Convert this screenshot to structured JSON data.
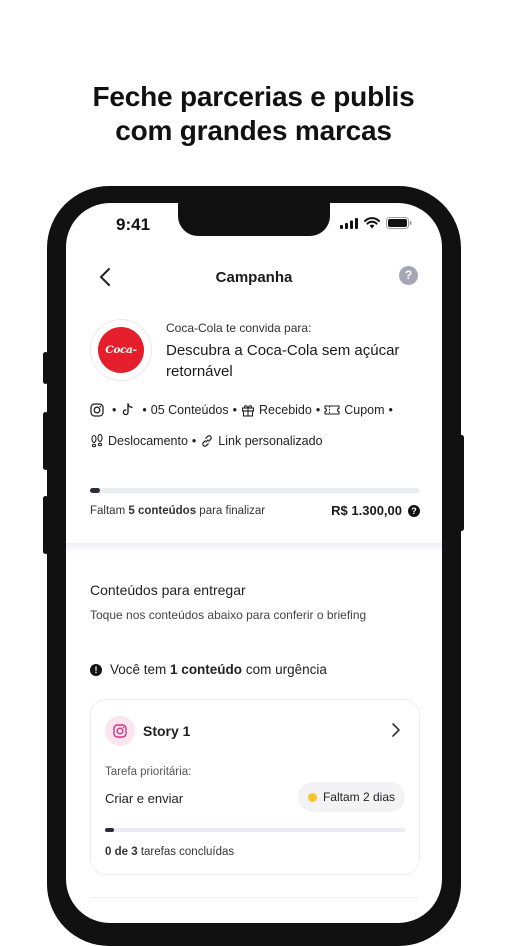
{
  "headline": {
    "line1": "Feche parcerias e publis",
    "line2": "com grandes marcas"
  },
  "status_bar": {
    "time": "9:41",
    "icons": [
      "signal-icon",
      "wifi-icon",
      "battery-icon"
    ]
  },
  "nav": {
    "title": "Campanha",
    "back_icon": "chevron-left-icon",
    "help_icon": "help-icon",
    "help_glyph": "?"
  },
  "campaign": {
    "brand_logo_text": "Coca-Cola",
    "invite_text": "Coca-Cola te convida para:",
    "name": "Descubra a Coca-Cola sem açúcar retornável",
    "meta_line1": [
      "05 Conteúdos",
      "Recebido",
      "Cupom"
    ],
    "meta_line2": [
      "Deslocamento",
      "Link personalizado"
    ],
    "progress_fraction": 0.03,
    "remaining_prefix": "Faltam",
    "remaining_bold": "5 conteúdos",
    "remaining_suffix": "para finalizar",
    "amount": "R$ 1.300,00"
  },
  "deliverables": {
    "title": "Conteúdos para entregar",
    "subtitle": "Toque nos conteúdos abaixo para conferir o briefing",
    "urgent_prefix": "Você tem",
    "urgent_bold": "1 conteúdo",
    "urgent_suffix": "com urgência",
    "card": {
      "title": "Story 1",
      "priority_label": "Tarefa prioritária:",
      "task": "Criar e enviar",
      "deadline": "Faltam 2 dias",
      "progress_fraction": 0.03,
      "done_bold": "0 de 3",
      "done_suffix": "tarefas concluídas"
    }
  },
  "colors": {
    "accent_dark": "#2c2c3a",
    "coca_red": "#e41e2b",
    "warning_yellow": "#f6c42d",
    "instagram_pink": "#fbe6f0"
  }
}
